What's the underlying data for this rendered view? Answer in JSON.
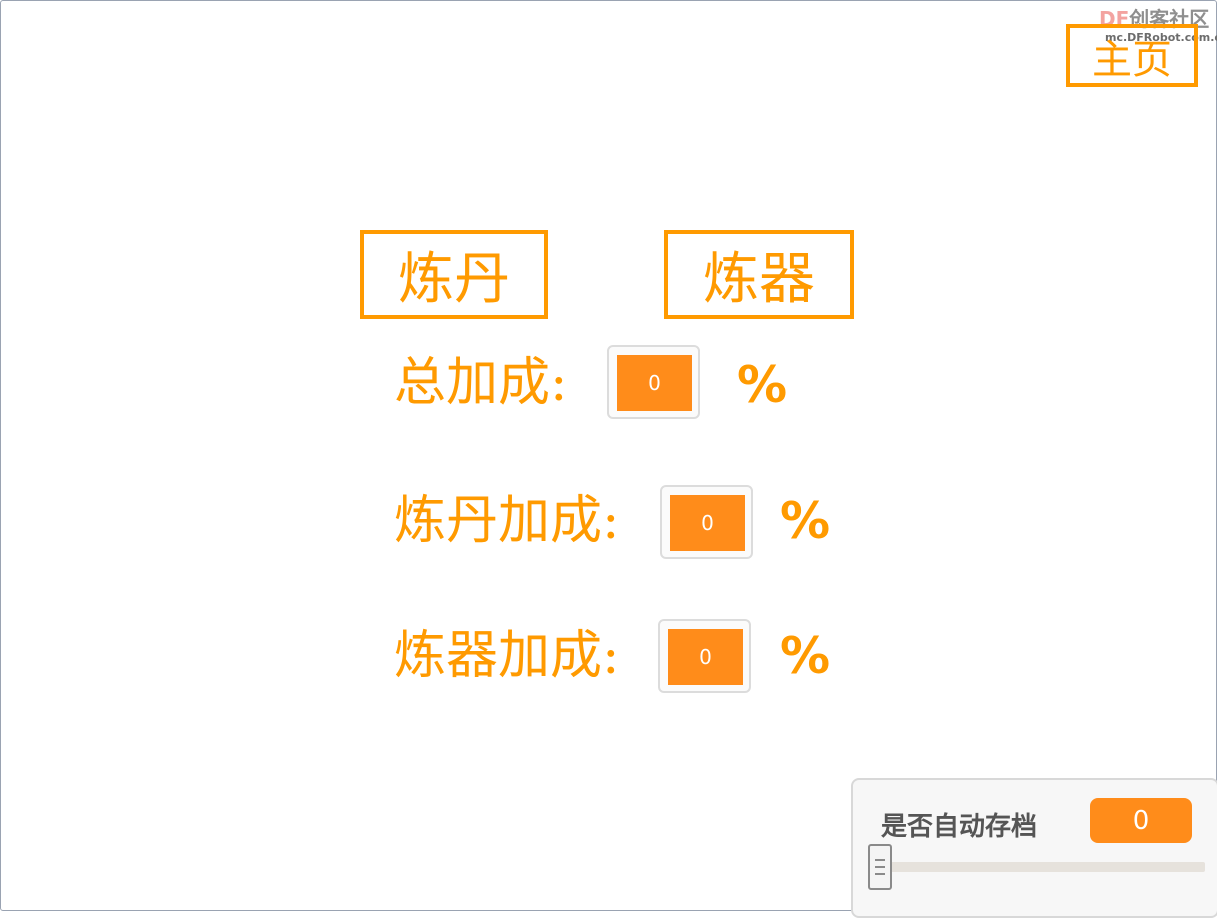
{
  "watermark": {
    "brand_df": "DF",
    "brand_cn": "创客社区",
    "url": "mc.DFRobot.com.cn"
  },
  "nav": {
    "home_label": "主页",
    "alchemy_label": "炼丹",
    "forge_label": "炼器"
  },
  "bonuses": {
    "total_label": "总加成:",
    "total_value": "0",
    "alchemy_label": "炼丹加成:",
    "alchemy_value": "0",
    "forge_label": "炼器加成:",
    "forge_value": "0",
    "percent_sign": "%"
  },
  "autosave": {
    "label": "是否自动存档",
    "value": "0",
    "slider_level": 0
  },
  "colors": {
    "accent": "#ff9a00",
    "monitor_fill": "#ff8c1a",
    "label_gray": "#555555"
  }
}
